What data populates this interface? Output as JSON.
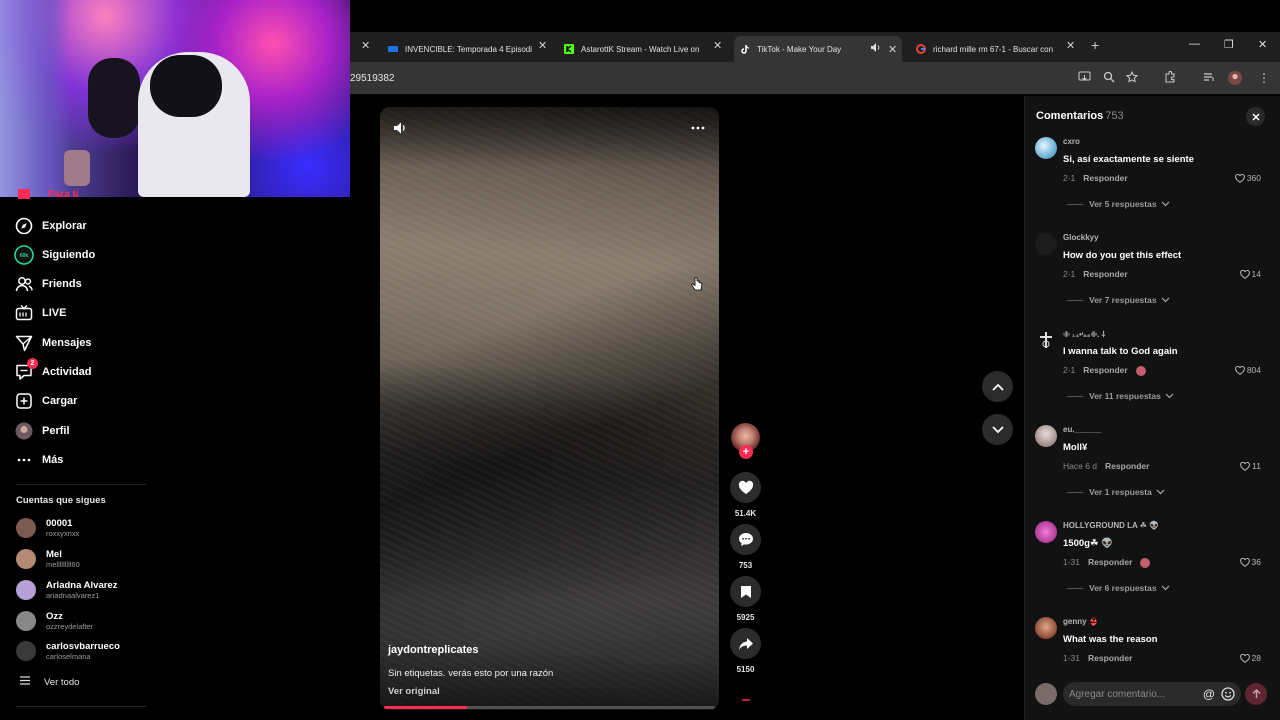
{
  "browser": {
    "tabs": [
      {
        "title": "INVENCIBLE: Temporada 4 Episodi",
        "favicon_color": "#1a73e8"
      },
      {
        "title": "AstarottK Stream - Watch Live on",
        "favicon_color": "#53fc18"
      },
      {
        "title": "TikTok - Make Your Day",
        "favicon_color": "#ffffff",
        "active": true
      },
      {
        "title": "richard mille rm 67-1 - Buscar con",
        "favicon_color": "#ea4335"
      }
    ],
    "new_tab": "+",
    "url": "29519382"
  },
  "nav": {
    "partial_item": "Para ti",
    "items": [
      {
        "label": "Explorar",
        "icon": "compass-icon"
      },
      {
        "label": "Siguiendo",
        "icon": "following-icon"
      },
      {
        "label": "Friends",
        "icon": "friends-icon"
      },
      {
        "label": "LIVE",
        "icon": "live-icon"
      },
      {
        "label": "Mensajes",
        "icon": "messages-icon"
      },
      {
        "label": "Actividad",
        "icon": "activity-icon",
        "badge": "2"
      },
      {
        "label": "Cargar",
        "icon": "upload-icon"
      },
      {
        "label": "Perfil",
        "icon": "profile-avatar"
      },
      {
        "label": "Más",
        "icon": "more-icon"
      }
    ],
    "following_title": "Cuentas que sigues",
    "following": [
      {
        "name": "00001",
        "user": "roxxyxnxx",
        "color": "#7a5a52"
      },
      {
        "name": "Mel",
        "user": "melllllllll60",
        "color": "#b58a74"
      },
      {
        "name": "Arladna Alvarez",
        "user": "ariadnaalvarez1",
        "color": "#b7a0d8"
      },
      {
        "name": "Ozz",
        "user": "ozzreydelafter",
        "color": "#888888"
      },
      {
        "name": "carlosvbarrueco",
        "user": "carloselmana",
        "color": "#3a3a3a"
      }
    ],
    "see_all": "Ver todo"
  },
  "video": {
    "author": "jaydontreplicates",
    "description": "Sin etiquetas. verás esto por una razón",
    "view_original": "Ver original",
    "progress": 0.25
  },
  "actions": {
    "likes": "51.4K",
    "comments": "753",
    "saves": "5925",
    "shares": "5150"
  },
  "comments_panel": {
    "title": "Comentarios",
    "count": "753",
    "reply_label": "Responder",
    "input_placeholder": "Agregar comentario...",
    "items": [
      {
        "user": "cxro",
        "text": "Si, así exactamente se siente",
        "date": "2-1",
        "likes": "360",
        "more": "Ver 5 respuestas",
        "avatar_color": "#8fc7e0",
        "creator_liked": false
      },
      {
        "user": "Glockkyy",
        "text": "How do you get this effect",
        "date": "2-1",
        "likes": "14",
        "more": "Ver 7 respuestas",
        "avatar_color": "#1c1c1c",
        "creator_liked": false
      },
      {
        "user": "✙ ₁₄•ᶦ₈₈✙. ⸸",
        "text": "I wanna talk to God again",
        "date": "2-1",
        "likes": "804",
        "more": "Ver 11 respuestas",
        "avatar_color": "#d9d9d9",
        "creator_liked": true
      },
      {
        "user": "eu.______",
        "text": "Moll¥",
        "date": "Hace 6 d",
        "likes": "11",
        "more": "Ver 1 respuesta",
        "avatar_color": "#c9b9b5",
        "creator_liked": false
      },
      {
        "user": "HOLLYGROUND LA ☘ 👽",
        "text": "1500g☘ 👽",
        "date": "1-31",
        "likes": "36",
        "more": "Ver 6 respuestas",
        "avatar_color": "#d34fb7",
        "creator_liked": true
      },
      {
        "user": "genny 👙",
        "text": "What was the reason",
        "date": "1-31",
        "likes": "28",
        "more": "",
        "avatar_color": "#b07050",
        "creator_liked": false
      }
    ]
  },
  "colors": {
    "accent": "#fe2c55",
    "background": "#000000",
    "panel": "#121212"
  }
}
